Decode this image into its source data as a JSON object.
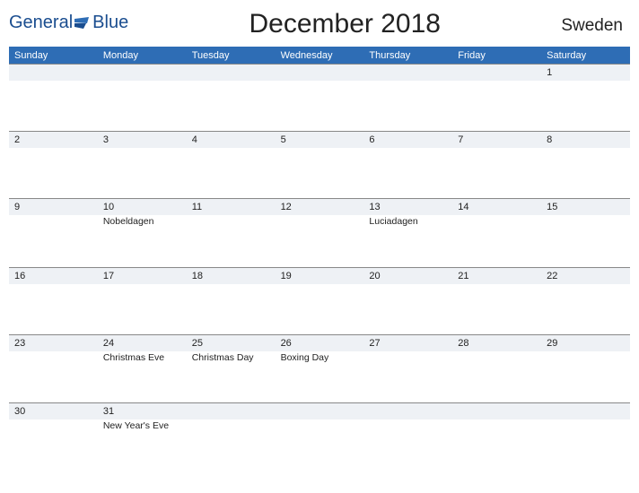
{
  "header": {
    "logo_text": "General",
    "logo_text2": "Blue",
    "title": "December 2018",
    "region": "Sweden"
  },
  "days": [
    "Sunday",
    "Monday",
    "Tuesday",
    "Wednesday",
    "Thursday",
    "Friday",
    "Saturday"
  ],
  "weeks": [
    {
      "nums": [
        "",
        "",
        "",
        "",
        "",
        "",
        "1"
      ],
      "events": [
        "",
        "",
        "",
        "",
        "",
        "",
        ""
      ]
    },
    {
      "nums": [
        "2",
        "3",
        "4",
        "5",
        "6",
        "7",
        "8"
      ],
      "events": [
        "",
        "",
        "",
        "",
        "",
        "",
        ""
      ]
    },
    {
      "nums": [
        "9",
        "10",
        "11",
        "12",
        "13",
        "14",
        "15"
      ],
      "events": [
        "",
        "Nobeldagen",
        "",
        "",
        "Luciadagen",
        "",
        ""
      ]
    },
    {
      "nums": [
        "16",
        "17",
        "18",
        "19",
        "20",
        "21",
        "22"
      ],
      "events": [
        "",
        "",
        "",
        "",
        "",
        "",
        ""
      ]
    },
    {
      "nums": [
        "23",
        "24",
        "25",
        "26",
        "27",
        "28",
        "29"
      ],
      "events": [
        "",
        "Christmas Eve",
        "Christmas Day",
        "Boxing Day",
        "",
        "",
        ""
      ]
    },
    {
      "nums": [
        "30",
        "31",
        "",
        "",
        "",
        "",
        ""
      ],
      "events": [
        "",
        "New Year's Eve",
        "",
        "",
        "",
        "",
        ""
      ]
    }
  ]
}
